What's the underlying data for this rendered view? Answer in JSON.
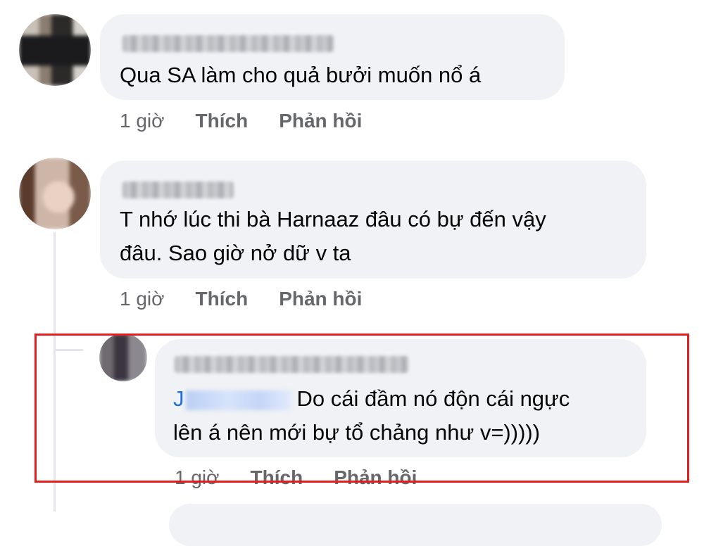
{
  "comments": [
    {
      "text": "Qua SA làm cho quả bưởi muốn nổ á",
      "time": "1 giờ",
      "like_label": "Thích",
      "reply_label": "Phản hồi"
    },
    {
      "text_line1": "T nhớ lúc thi bà Harnaaz đâu có bự đến vậy",
      "text_line2": "đâu. Sao giờ nở dữ v ta",
      "time": "1 giờ",
      "like_label": "Thích",
      "reply_label": "Phản hồi"
    },
    {
      "mention_initial": "J",
      "text_line1": "Do cái đầm nó độn cái ngực",
      "text_line2": "lên á nên mới bự tổ chảng như v=)))))",
      "time": "1 giờ",
      "like_label": "Thích",
      "reply_label": "Phản hồi"
    }
  ],
  "colors": {
    "bubble": "#f0f2f5",
    "meta_text": "#65676b",
    "mention": "#216fdb",
    "highlight": "#e11f1f"
  }
}
